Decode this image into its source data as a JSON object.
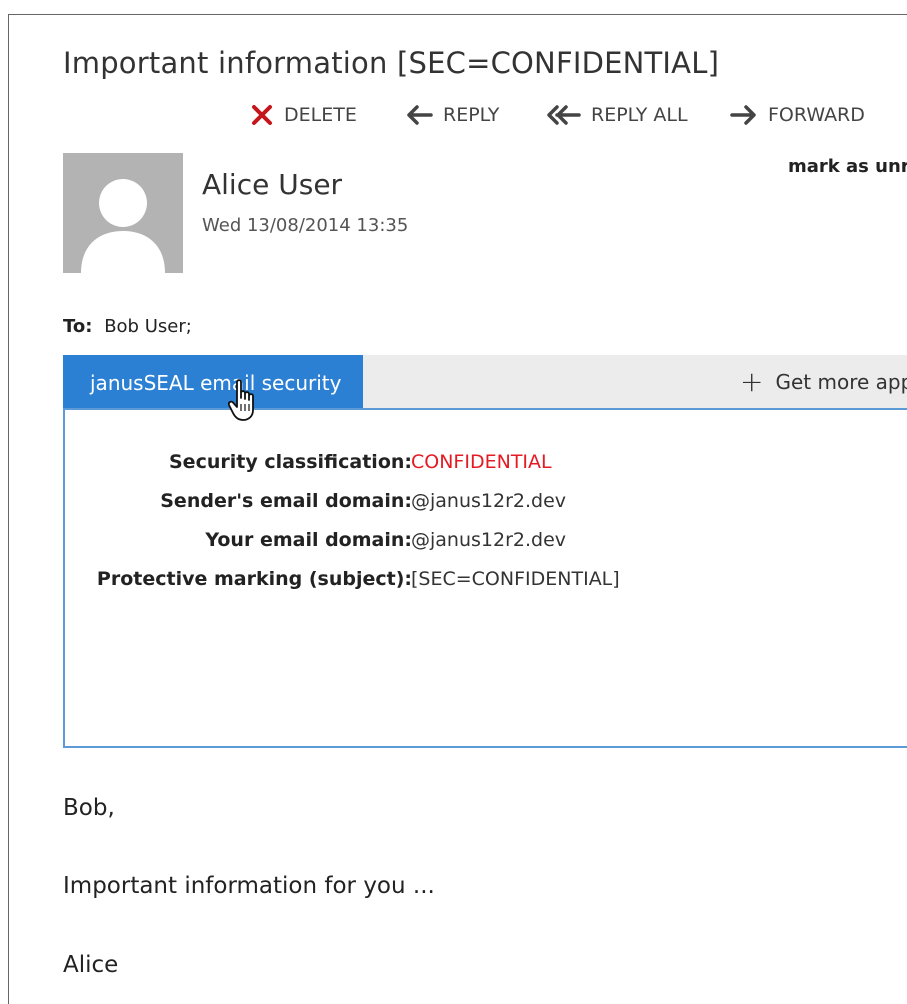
{
  "email": {
    "subject": "Important information [SEC=CONFIDENTIAL]",
    "sender_name": "Alice User",
    "sent_date": "Wed 13/08/2014 13:35",
    "mark_as_unread": "mark as unr",
    "to_label": "To:",
    "to_value": "Bob User;"
  },
  "toolbar": {
    "delete": "DELETE",
    "reply": "REPLY",
    "reply_all": "REPLY ALL",
    "forward": "FORWARD"
  },
  "icons": {
    "delete": "x-icon",
    "reply": "arrow-left-icon",
    "reply_all": "double-arrow-left-icon",
    "forward": "arrow-right-icon",
    "avatar": "person-placeholder-icon",
    "cursor": "hand-pointer-icon"
  },
  "addin": {
    "tab_label": "janusSEAL email security",
    "get_more_plus": "+",
    "get_more_label": "Get more app",
    "fields": [
      {
        "label": "Security classification:",
        "value": "CONFIDENTIAL"
      },
      {
        "label": "Sender's email domain:",
        "value": "@janus12r2.dev"
      },
      {
        "label": "Your email domain:",
        "value": "@janus12r2.dev"
      },
      {
        "label": "Protective marking (subject):",
        "value": "[SEC=CONFIDENTIAL]"
      }
    ]
  },
  "body": {
    "greeting": "Bob,",
    "line": "Important information for you ...",
    "signoff": "Alice"
  },
  "colors": {
    "accent": "#2c80d3",
    "panel_border": "#5c9ad8",
    "classification": "#e51b23",
    "delete_icon": "#c4161c"
  }
}
